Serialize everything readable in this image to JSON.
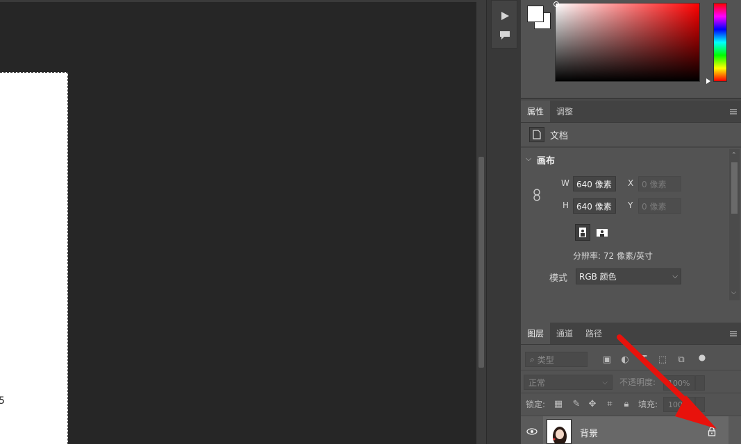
{
  "canvas": {
    "mark": "5"
  },
  "strip": {
    "buttons": [
      "play-icon",
      "comment-icon"
    ]
  },
  "properties": {
    "tabs": [
      {
        "label": "属性",
        "active": true
      },
      {
        "label": "调整",
        "active": false
      }
    ],
    "doc_label": "文档",
    "section_title": "画布",
    "w_label": "W",
    "w_value": "640 像素",
    "h_label": "H",
    "h_value": "640 像素",
    "x_label": "X",
    "x_placeholder": "0 像素",
    "y_label": "Y",
    "y_placeholder": "0 像素",
    "resolution": "分辨率: 72 像素/英寸",
    "mode_label": "模式",
    "mode_value": "RGB 颜色"
  },
  "layers": {
    "tabs": [
      {
        "label": "图层",
        "active": true
      },
      {
        "label": "通道",
        "active": false
      },
      {
        "label": "路径",
        "active": false
      }
    ],
    "filter_placeholder": "类型",
    "blend_mode": "正常",
    "opacity_label": "不透明度:",
    "opacity_value": "100%",
    "lock_label": "锁定:",
    "fill_label": "填充:",
    "fill_value": "100%",
    "layer_name": "背景"
  },
  "colors": {
    "accent_arrow": "#e8120c"
  }
}
